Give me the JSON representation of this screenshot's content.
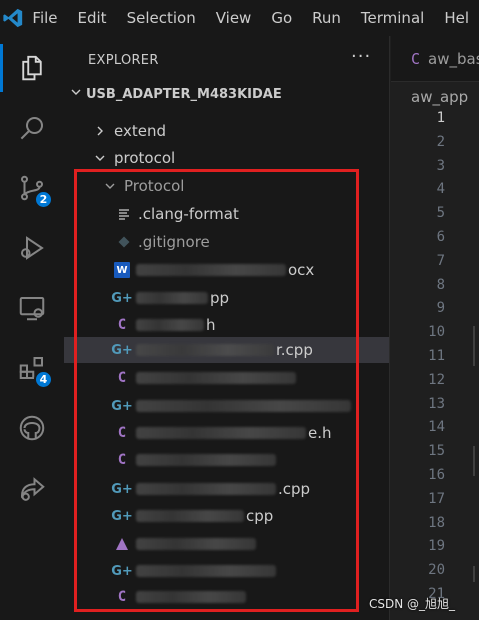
{
  "menubar": {
    "items": [
      "File",
      "Edit",
      "Selection",
      "View",
      "Go",
      "Run",
      "Terminal",
      "Hel"
    ]
  },
  "activity_bar": {
    "source_control_badge": "2",
    "extensions_badge": "4"
  },
  "sidebar": {
    "title": "EXPLORER",
    "more_label": "···",
    "project": "USB_ADAPTER_M483KIDAE",
    "folders": {
      "extend": "extend",
      "protocol": "protocol",
      "protocol_sub": "Protocol"
    },
    "files": {
      "clang_format": ".clang-format",
      "gitignore": ".gitignore",
      "docx_suffix": "ocx",
      "cpp1_suffix": "pp",
      "h1_suffix": "h",
      "cpp2_suffix": "r.cpp",
      "h2_suffix": "e.h",
      "cpp3_suffix": ".cpp",
      "cpp4_suffix": "cpp"
    }
  },
  "editor": {
    "tab_label": "aw_bas",
    "breadcrumb": "aw_app",
    "line_numbers": [
      "1",
      "2",
      "3",
      "4",
      "5",
      "6",
      "7",
      "8",
      "9",
      "10",
      "11",
      "12",
      "13",
      "14",
      "15",
      "16",
      "17",
      "18",
      "19",
      "20",
      "21"
    ]
  },
  "watermark": "CSDN @_旭旭_",
  "colors": {
    "accent": "#0078d4",
    "highlight_box": "#e02020",
    "c_file_icon": "#a074c4",
    "cpp_file_icon": "#519aba"
  }
}
